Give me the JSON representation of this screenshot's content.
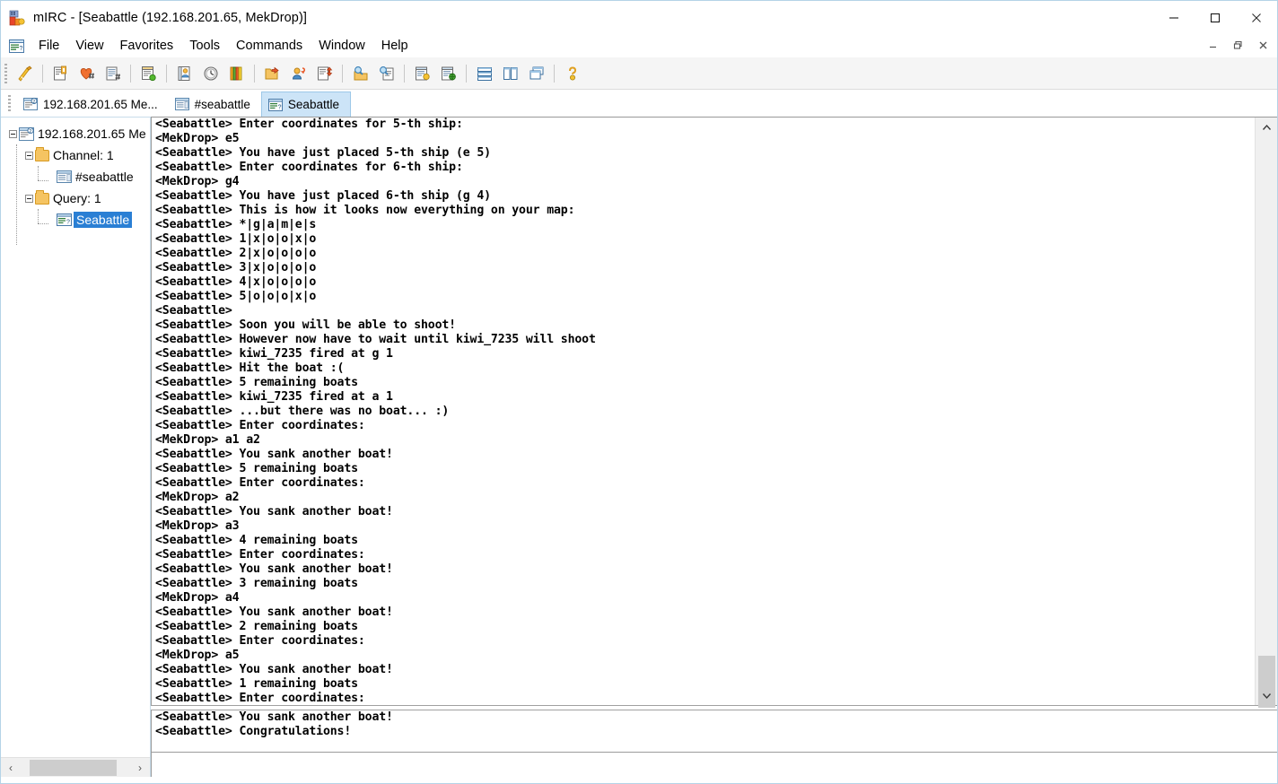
{
  "window": {
    "title": "mIRC - [Seabattle (192.168.201.65, MekDrop)]",
    "app_icon": "mirc-logo-icon",
    "minimize_label": "—",
    "maximize_label": "□",
    "close_label": "✕",
    "accent_color": "#cce4f7",
    "border_color": "#b5d3e7"
  },
  "mdi": {
    "minimize_label": "－",
    "restore_label": "❐",
    "close_label": "✕"
  },
  "menubar": {
    "icon": "server-window-icon",
    "items": [
      {
        "label": "File"
      },
      {
        "label": "View"
      },
      {
        "label": "Favorites"
      },
      {
        "label": "Tools"
      },
      {
        "label": "Commands"
      },
      {
        "label": "Window"
      },
      {
        "label": "Help"
      }
    ]
  },
  "toolbar": {
    "groups": [
      [
        "connect-lightning-icon"
      ],
      [
        "options-icon",
        "favorites-heart-icon",
        "channels-list-icon"
      ],
      [
        "channel-central-icon"
      ],
      [
        "address-book-icon",
        "history-clock-icon",
        "notify-list-icon"
      ],
      [
        "open-folder-icon",
        "user-central-icon",
        "dcc-send-icon"
      ],
      [
        "dcc-get-folder-icon",
        "dcc-chat-find-icon"
      ],
      [
        "script-editor-icon",
        "url-list-icon"
      ],
      [
        "tile-horizontal-icon",
        "tile-vertical-icon",
        "cascade-windows-icon"
      ],
      [
        "help-question-icon"
      ]
    ]
  },
  "tabs": [
    {
      "label": "192.168.201.65 Me...",
      "icon": "status-window-icon",
      "active": false
    },
    {
      "label": "#seabattle",
      "icon": "channel-window-icon",
      "active": false
    },
    {
      "label": "Seabattle",
      "icon": "query-window-icon",
      "active": true
    }
  ],
  "sidebar": {
    "tree": [
      {
        "label": "192.168.201.65 Me",
        "icon": "status-window-icon",
        "depth": 0,
        "expander": "collapse",
        "selected": false
      },
      {
        "label": "Channel: 1",
        "icon": "folder-icon",
        "depth": 1,
        "expander": "collapse",
        "selected": false
      },
      {
        "label": "#seabattle",
        "icon": "channel-window-icon",
        "depth": 2,
        "expander": "none",
        "selected": false
      },
      {
        "label": "Query: 1",
        "icon": "folder-icon",
        "depth": 1,
        "expander": "collapse",
        "selected": false
      },
      {
        "label": "Seabattle",
        "icon": "query-window-icon",
        "depth": 2,
        "expander": "none",
        "selected": true
      }
    ],
    "hscroll": {
      "left_arrow": "‹",
      "right_arrow": "›"
    }
  },
  "chat": {
    "main_log": "<Seabattle> Enter coordinates for 5-th ship:\n<MekDrop> e5\n<Seabattle> You have just placed 5-th ship (e 5)\n<Seabattle> Enter coordinates for 6-th ship:\n<MekDrop> g4\n<Seabattle> You have just placed 6-th ship (g 4)\n<Seabattle> This is how it looks now everything on your map:\n<Seabattle> *|g|a|m|e|s\n<Seabattle> 1|x|o|o|x|o\n<Seabattle> 2|x|o|o|o|o\n<Seabattle> 3|x|o|o|o|o\n<Seabattle> 4|x|o|o|o|o\n<Seabattle> 5|o|o|o|x|o\n<Seabattle> \n<Seabattle> Soon you will be able to shoot!\n<Seabattle> However now have to wait until kiwi_7235 will shoot\n<Seabattle> kiwi_7235 fired at g 1\n<Seabattle> Hit the boat :(\n<Seabattle> 5 remaining boats\n<Seabattle> kiwi_7235 fired at a 1\n<Seabattle> ...but there was no boat... :)\n<Seabattle> Enter coordinates:\n<MekDrop> a1 a2\n<Seabattle> You sank another boat!\n<Seabattle> 5 remaining boats\n<Seabattle> Enter coordinates:\n<MekDrop> a2\n<Seabattle> You sank another boat!\n<MekDrop> a3\n<Seabattle> 4 remaining boats\n<Seabattle> Enter coordinates:\n<Seabattle> You sank another boat!\n<Seabattle> 3 remaining boats\n<MekDrop> a4\n<Seabattle> You sank another boat!\n<Seabattle> 2 remaining boats\n<Seabattle> Enter coordinates:\n<MekDrop> a5\n<Seabattle> You sank another boat!\n<Seabattle> 1 remaining boats\n<Seabattle> Enter coordinates:\n<MekDrop> e5",
    "bottom_log": "<Seabattle> You sank another boat!\n<Seabattle> Congratulations!",
    "input_value": "",
    "input_placeholder": "",
    "vscroll": {
      "up_arrow": "⌃",
      "down_arrow": "⌄"
    }
  },
  "game_state": {
    "map_header": "*|g|a|m|e|s",
    "map_rows": [
      "1|x|o|o|x|o",
      "2|x|o|o|o|o",
      "3|x|o|o|o|o",
      "4|x|o|o|o|o",
      "5|o|o|o|x|o"
    ],
    "opponent": "kiwi_7235",
    "player": "MekDrop",
    "bot": "Seabattle",
    "remaining_boats_sequence": [
      5,
      5,
      4,
      3,
      2,
      1
    ],
    "final_message": "Congratulations!"
  }
}
